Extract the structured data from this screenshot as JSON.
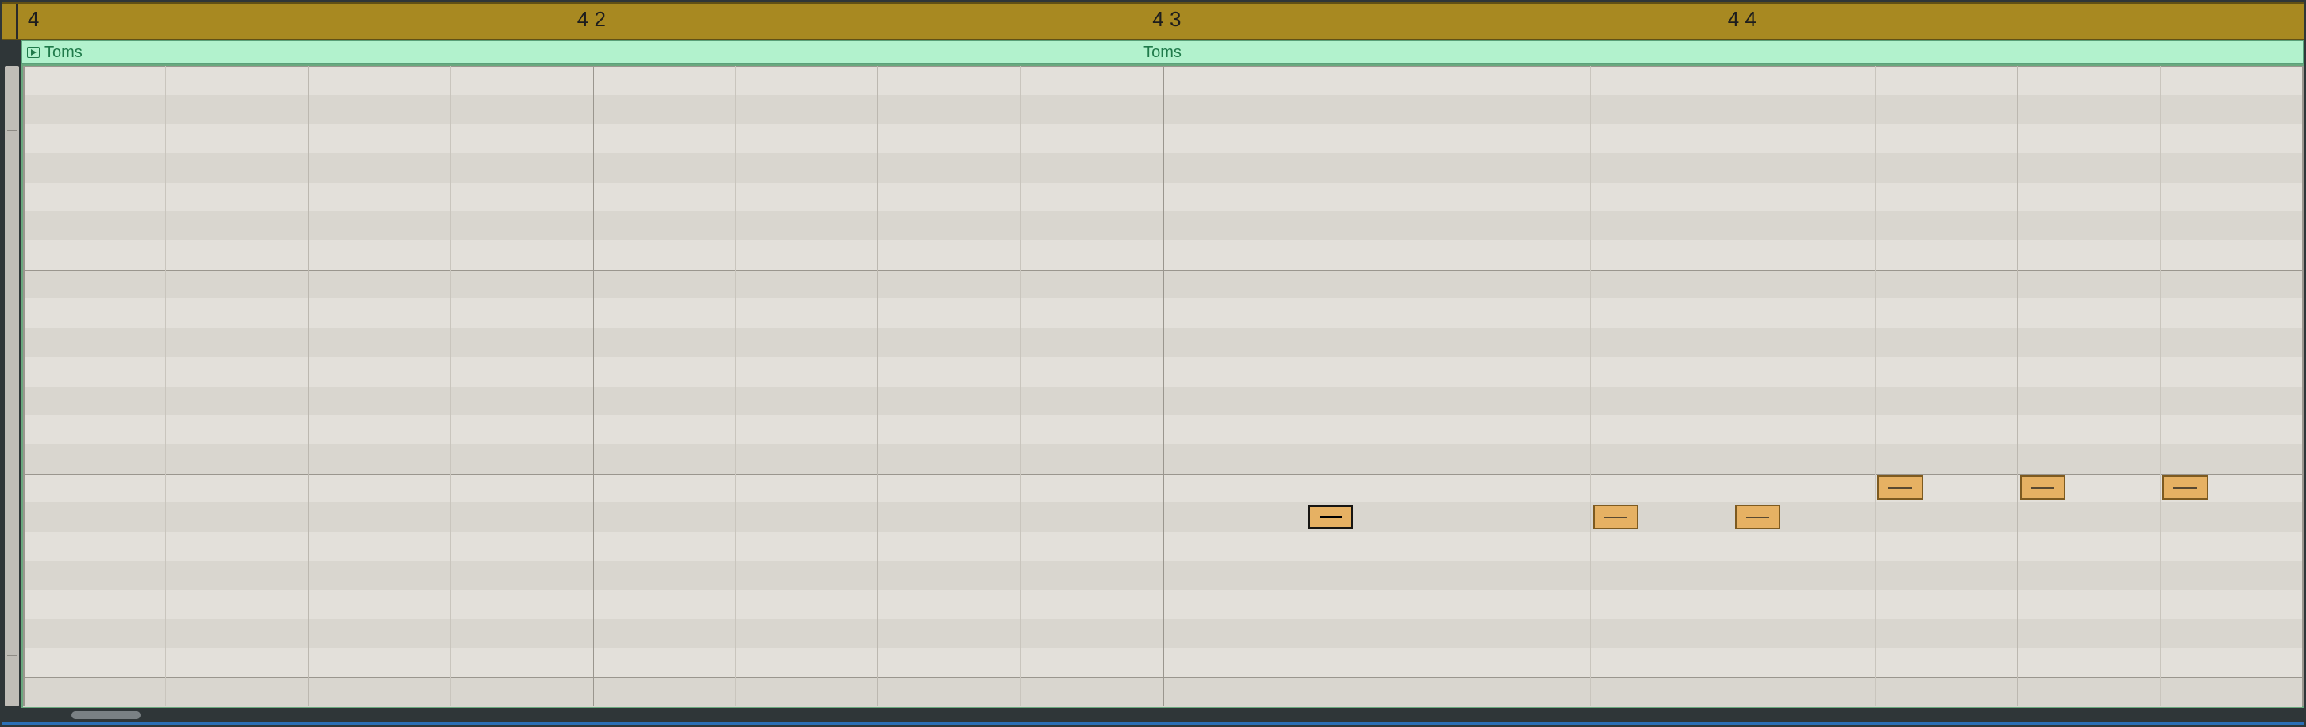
{
  "ruler": {
    "bar_label": "4",
    "beats": [
      "4 2",
      "4 3",
      "4 4"
    ],
    "beat_count": 4,
    "subdivisions_per_beat": 4
  },
  "clip": {
    "name_left": "Toms",
    "name_center": "Toms"
  },
  "grid": {
    "row_count": 22
  },
  "notes": [
    {
      "row": 15,
      "col_16th": 9,
      "selected": true
    },
    {
      "row": 15,
      "col_16th": 11,
      "selected": false
    },
    {
      "row": 15,
      "col_16th": 12,
      "selected": false
    },
    {
      "row": 14,
      "col_16th": 13,
      "selected": false
    },
    {
      "row": 14,
      "col_16th": 14,
      "selected": false
    },
    {
      "row": 14,
      "col_16th": 15,
      "selected": false
    }
  ],
  "scrollbar": {
    "thumb_position_pct": 3,
    "thumb_width_pct": 3
  }
}
